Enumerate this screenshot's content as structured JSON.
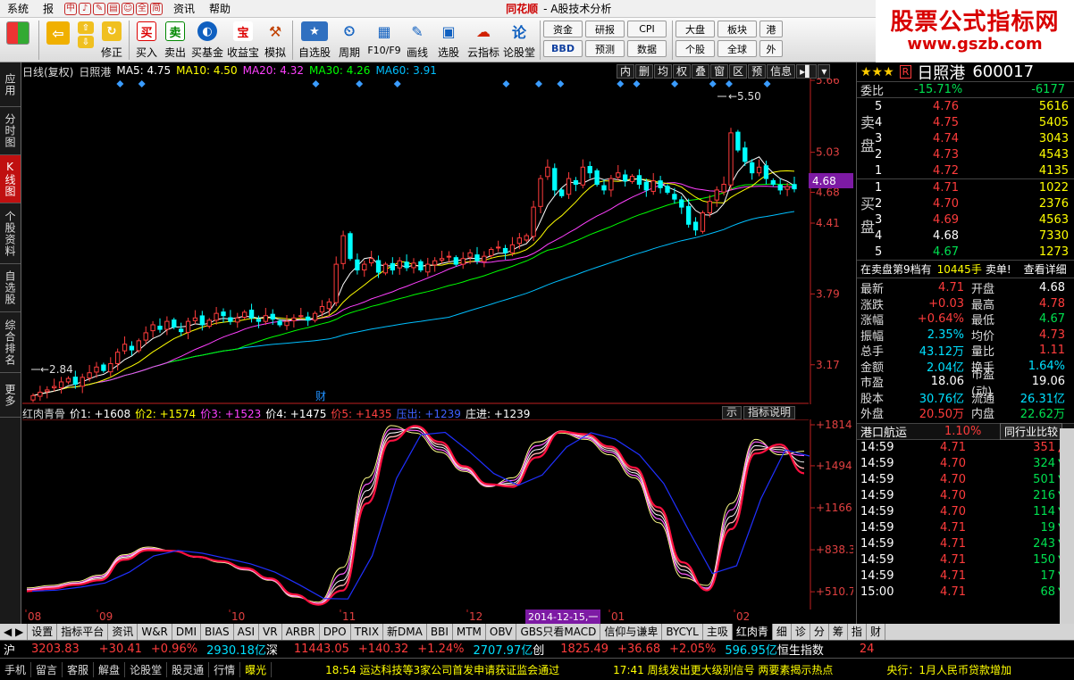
{
  "menubar": {
    "items": [
      "系统",
      "报"
    ],
    "icons_text": [
      "中",
      "♪",
      "✎",
      "▤",
      "☺"
    ],
    "quick": [
      "全",
      "简"
    ],
    "items2": [
      "资讯",
      "帮助"
    ],
    "brand": "同花顺",
    "app_title": "- A股技术分析"
  },
  "watermark": {
    "line1": "股票公式指标网",
    "line2": "www.gszb.com"
  },
  "toolbar": {
    "buttons": [
      "修正",
      "买入",
      "卖出",
      "买基金",
      "收益宝",
      "模拟",
      "自选股",
      "周期",
      "F10/F9",
      "画线",
      "选股",
      "云指标",
      "论股堂"
    ],
    "icon_glyphs": [
      "买",
      "卖",
      "◐",
      "宝",
      "⚒",
      "★",
      "⏲",
      "▦",
      "✎",
      "▣",
      "☁",
      "论"
    ],
    "pairs": [
      [
        "资金",
        "BBD"
      ],
      [
        "研报",
        "预测"
      ],
      [
        "CPI",
        "数据"
      ],
      [
        "大盘",
        "个股"
      ],
      [
        "板块",
        "全球"
      ],
      [
        "港",
        "外"
      ]
    ]
  },
  "left_tabs": [
    "应用",
    "分时图",
    "K线图",
    "个股资料",
    "自选股",
    "综合排名",
    "更多"
  ],
  "main_chart": {
    "title": "日线(复权)",
    "stock": "日照港",
    "ma": [
      {
        "label": "MA5: 4.75",
        "color": "#ffffff"
      },
      {
        "label": "MA10: 4.50",
        "color": "#ffff00"
      },
      {
        "label": "MA20: 4.32",
        "color": "#ff40ff"
      },
      {
        "label": "MA30: 4.26",
        "color": "#00ff00"
      },
      {
        "label": "MA60: 3.91",
        "color": "#00bfff"
      }
    ],
    "buttons": [
      "内",
      "删",
      "均",
      "权",
      "叠",
      "窗",
      "区",
      "预",
      "信息"
    ],
    "y_labels": [
      "5.66",
      "5.03",
      "4.68",
      "4.41",
      "3.79",
      "3.17"
    ],
    "high_label": "5.50",
    "low_label": "2.84",
    "event_label": "财",
    "current_price": "4.68"
  },
  "sub_chart": {
    "name": "红肉青骨",
    "params": [
      {
        "label": "价1: +1608",
        "color": "#ffffff"
      },
      {
        "label": "价2: +1574",
        "color": "#ffff00"
      },
      {
        "label": "价3: +1523",
        "color": "#ff40ff"
      },
      {
        "label": "价4: +1475",
        "color": "#ffffff"
      },
      {
        "label": "价5: +1435",
        "color": "#ff4040"
      },
      {
        "label": "压出: +1239",
        "color": "#4040ff"
      },
      {
        "label": "庄进: +1239",
        "color": "#ffffff"
      }
    ],
    "buttons": [
      "示",
      "指标说明"
    ],
    "y_labels": [
      "+1814",
      "+1494",
      "+1166",
      "+838.3",
      "+510.7"
    ]
  },
  "date_axis": {
    "labels": [
      "08",
      "09",
      "10",
      "11",
      "12",
      "01",
      "02"
    ],
    "cursor_date": "2014-12-15,一"
  },
  "bottom_tabs": [
    "设置",
    "指标平台",
    "资讯",
    "W&R",
    "DMI",
    "BIAS",
    "ASI",
    "VR",
    "ARBR",
    "DPO",
    "TRIX",
    "新DMA",
    "BBI",
    "MTM",
    "OBV",
    "GBS只看MACD",
    "信仰与谦卑",
    "BYCYL",
    "主吸",
    "红肉青",
    "细",
    "诊",
    "分",
    "筹",
    "指",
    "财"
  ],
  "index_bar": {
    "sh": {
      "name": "沪",
      "price": "3203.83",
      "chg": "+30.41",
      "pct": "+0.96%",
      "amt": "2930.18亿"
    },
    "sz": {
      "name": "深",
      "price": "11443.05",
      "chg": "+140.32",
      "pct": "+1.24%",
      "amt": "2707.97亿"
    },
    "cy": {
      "name": "创",
      "price": "1825.49",
      "chg": "+36.68",
      "pct": "+2.05%",
      "amt": "596.95亿"
    },
    "hk": {
      "name": "恒生指数",
      "value": "24"
    }
  },
  "status_bar": {
    "tabs": [
      "手机",
      "留言",
      "客服",
      "解盘",
      "论股堂",
      "股灵通",
      "行情"
    ],
    "light": "曝光",
    "news1": "18:54 运达科技等3家公司首发申请获证监会通过",
    "news2": "17:41 周线发出更大级别信号 两要素揭示热点",
    "news3": "央行：1月人民币贷款增加"
  },
  "right_panel": {
    "stars": "★★★",
    "r_badge": "R",
    "name": "日照港",
    "code": "600017",
    "ratio_label": "委比",
    "ratio": "-15.71%",
    "ratio_diff": "-6177",
    "sell_label": "卖盘",
    "buy_label": "买盘",
    "sell": [
      {
        "n": "5",
        "p": "4.76",
        "v": "5616"
      },
      {
        "n": "4",
        "p": "4.75",
        "v": "5405"
      },
      {
        "n": "3",
        "p": "4.74",
        "v": "3043"
      },
      {
        "n": "2",
        "p": "4.73",
        "v": "4543"
      },
      {
        "n": "1",
        "p": "4.72",
        "v": "4135"
      }
    ],
    "buy": [
      {
        "n": "1",
        "p": "4.71",
        "v": "1022"
      },
      {
        "n": "2",
        "p": "4.70",
        "v": "2376"
      },
      {
        "n": "3",
        "p": "4.69",
        "v": "4563"
      },
      {
        "n": "4",
        "p": "4.68",
        "v": "7330"
      },
      {
        "n": "5",
        "p": "4.67",
        "v": "1273"
      }
    ],
    "notice": {
      "pre": "在卖盘第9档有",
      "vol": "10445手",
      "action": "卖单!",
      "link": "查看详细"
    },
    "stats": [
      {
        "k": "最新",
        "v": "4.71",
        "c": "red",
        "k2": "开盘",
        "v2": "4.68",
        "c2": "white"
      },
      {
        "k": "涨跌",
        "v": "+0.03",
        "c": "red",
        "k2": "最高",
        "v2": "4.78",
        "c2": "red"
      },
      {
        "k": "涨幅",
        "v": "+0.64%",
        "c": "red",
        "k2": "最低",
        "v2": "4.67",
        "c2": "green"
      },
      {
        "k": "振幅",
        "v": "2.35%",
        "c": "cyan",
        "k2": "均价",
        "v2": "4.73",
        "c2": "red"
      },
      {
        "k": "总手",
        "v": "43.12万",
        "c": "cyan",
        "k2": "量比",
        "v2": "1.11",
        "c2": "red"
      },
      {
        "k": "金额",
        "v": "2.04亿",
        "c": "cyan",
        "k2": "换手",
        "v2": "1.64%",
        "c2": "cyan"
      },
      {
        "k": "市盈",
        "v": "18.06",
        "c": "white",
        "k2": "市盈(动)",
        "v2": "19.06",
        "c2": "white"
      },
      {
        "k": "股本",
        "v": "30.76亿",
        "c": "cyan",
        "k2": "流通",
        "v2": "26.31亿",
        "c2": "cyan"
      },
      {
        "k": "外盘",
        "v": "20.50万",
        "c": "red",
        "k2": "内盘",
        "v2": "22.62万",
        "c2": "green"
      }
    ],
    "sector": {
      "name": "港口航运",
      "pct": "1.10%",
      "compare": "同行业比较"
    },
    "ticks": [
      {
        "t": "14:59",
        "p": "4.71",
        "v": "351",
        "dir": "up"
      },
      {
        "t": "14:59",
        "p": "4.70",
        "v": "324",
        "dir": "down"
      },
      {
        "t": "14:59",
        "p": "4.70",
        "v": "501",
        "dir": "down"
      },
      {
        "t": "14:59",
        "p": "4.70",
        "v": "216",
        "dir": "down"
      },
      {
        "t": "14:59",
        "p": "4.70",
        "v": "114",
        "dir": "down"
      },
      {
        "t": "14:59",
        "p": "4.71",
        "v": "19",
        "dir": "down"
      },
      {
        "t": "14:59",
        "p": "4.71",
        "v": "243",
        "dir": "down"
      },
      {
        "t": "14:59",
        "p": "4.71",
        "v": "150",
        "dir": "down"
      },
      {
        "t": "14:59",
        "p": "4.71",
        "v": "17",
        "dir": "down"
      },
      {
        "t": "15:00",
        "p": "4.71",
        "v": "68",
        "dir": "down"
      }
    ]
  },
  "chart_data": [
    {
      "type": "candlestick",
      "ylim": [
        2.84,
        5.66
      ],
      "ma_last": {
        "MA5": 4.75,
        "MA10": 4.5,
        "MA20": 4.32,
        "MA30": 4.26,
        "MA60": 3.91
      },
      "closes": [
        2.9,
        2.93,
        2.95,
        2.98,
        3.02,
        3.05,
        3.0,
        3.06,
        3.1,
        3.15,
        3.12,
        3.18,
        3.28,
        3.35,
        3.3,
        3.38,
        3.45,
        3.52,
        3.48,
        3.55,
        3.5,
        3.46,
        3.55,
        3.58,
        3.52,
        3.56,
        3.62,
        3.6,
        3.55,
        3.58,
        3.63,
        3.58,
        3.55,
        3.6,
        3.57,
        3.52,
        3.55,
        3.58,
        3.6,
        3.56,
        3.62,
        3.68,
        3.72,
        4.05,
        4.3,
        4.1,
        4.0,
        4.05,
        4.1,
        3.98,
        4.05,
        4.0,
        4.08,
        4.02,
        4.06,
        4.0,
        4.05,
        4.08,
        4.1,
        4.12,
        4.05,
        4.1,
        4.15,
        4.08,
        4.12,
        4.18,
        4.2,
        4.15,
        4.22,
        4.28,
        4.3,
        4.55,
        4.8,
        4.9,
        4.7,
        4.65,
        4.8,
        4.75,
        4.9,
        4.85,
        4.75,
        4.7,
        4.8,
        4.85,
        4.78,
        4.82,
        4.75,
        4.7,
        4.78,
        4.72,
        4.68,
        4.62,
        4.55,
        4.4,
        4.35,
        4.5,
        4.6,
        4.7,
        4.75,
        5.2,
        5.05,
        4.95,
        4.85,
        4.9,
        4.8,
        4.75,
        4.7,
        4.73,
        4.71
      ]
    },
    {
      "type": "line",
      "ylim": [
        400,
        1814
      ],
      "x": [
        "08",
        "09",
        "10",
        "11",
        "12",
        "01",
        "02"
      ],
      "series": [
        {
          "name": "价1",
          "values": [
            540,
            560,
            590,
            640,
            800,
            860,
            830,
            780,
            740,
            680,
            600,
            470,
            430,
            700,
            1400,
            1808,
            1750,
            1600,
            1450,
            1330,
            1400,
            1680,
            1750,
            1700,
            1580,
            1400,
            1050,
            620,
            560,
            1200,
            1700,
            1580,
            1608
          ]
        },
        {
          "name": "价2",
          "values": [
            530,
            550,
            580,
            630,
            790,
            850,
            830,
            780,
            745,
            685,
            605,
            475,
            420,
            650,
            1350,
            1780,
            1770,
            1620,
            1460,
            1335,
            1380,
            1650,
            1760,
            1710,
            1600,
            1420,
            1080,
            650,
            540,
            1150,
            1680,
            1600,
            1574
          ]
        },
        {
          "name": "价3",
          "values": [
            525,
            545,
            575,
            620,
            780,
            845,
            830,
            780,
            745,
            690,
            610,
            480,
            415,
            600,
            1300,
            1750,
            1790,
            1640,
            1470,
            1340,
            1360,
            1620,
            1765,
            1720,
            1615,
            1440,
            1110,
            680,
            530,
            1100,
            1650,
            1620,
            1523
          ]
        },
        {
          "name": "价4",
          "values": [
            520,
            540,
            570,
            610,
            770,
            840,
            830,
            782,
            748,
            692,
            612,
            485,
            412,
            560,
            1250,
            1720,
            1800,
            1660,
            1480,
            1345,
            1345,
            1590,
            1765,
            1730,
            1630,
            1460,
            1140,
            710,
            525,
            1050,
            1620,
            1640,
            1475
          ]
        },
        {
          "name": "价5",
          "values": [
            515,
            535,
            565,
            600,
            760,
            835,
            830,
            784,
            750,
            695,
            615,
            490,
            410,
            520,
            1200,
            1690,
            1805,
            1680,
            1490,
            1350,
            1330,
            1560,
            1760,
            1740,
            1645,
            1480,
            1170,
            740,
            522,
            1000,
            1590,
            1660,
            1435
          ]
        }
      ]
    }
  ]
}
